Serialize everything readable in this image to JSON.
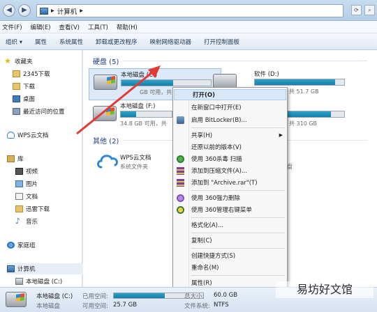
{
  "address": {
    "path": "计算机",
    "separator": "▸"
  },
  "menu": [
    "文件(F)",
    "编辑(E)",
    "查看(V)",
    "工具(T)",
    "帮助(H)"
  ],
  "toolbar": [
    "组织 ▾",
    "属性",
    "系统属性",
    "卸载或更改程序",
    "映射网络驱动器",
    "打开控制面板"
  ],
  "sidebar": {
    "favorites": "收藏夹",
    "fav_items": [
      "2345下载",
      "下载",
      "桌面",
      "最近访问的位置"
    ],
    "wps": "WPS云文档",
    "library": "库",
    "lib_items": [
      "视频",
      "图片",
      "文档",
      "迅雷下载",
      "音乐"
    ],
    "homegroup": "家庭组",
    "computer": "计算机",
    "computer_items": [
      "本地磁盘 (C:)"
    ]
  },
  "groups": {
    "hdd": "硬盘 (5)",
    "other": "其他 (2)"
  },
  "drives": [
    {
      "name": "本地磁盘 (C:)",
      "info": "GB 可用，共",
      "used_fraction": 0.58
    },
    {
      "name": "软件 (D:)",
      "info": "共 51.7 GB",
      "used_fraction": 0.9
    },
    {
      "name": "本地磁盘 (F:)",
      "info": "34.8 GB 可用，共",
      "used_fraction": 0.3
    },
    {
      "name": "",
      "info": "共 310 GB",
      "used_fraction": 0.85
    }
  ],
  "other_items": [
    {
      "name": "WPS云文档",
      "info": "系统文件夹"
    },
    {
      "name": "度网盘",
      "info": ""
    }
  ],
  "context_menu": {
    "open": "打开(O)",
    "open_new_window": "在新窗口中打开(E)",
    "bitlocker": "启用 BitLocker(B)...",
    "share": "共享(H)",
    "restore": "还原以前的版本(V)",
    "scan360": "使用 360杀毒 扫描",
    "add_archive": "添加到压缩文件(A)...",
    "add_rar": "添加到 \"Archive.rar\"(T)",
    "force_delete": "使用 360强力删除",
    "menu360": "使用 360管理右键菜单",
    "format": "格式化(A)...",
    "copy": "复制(C)",
    "shortcut": "创建快捷方式(S)",
    "rename": "重命名(M)",
    "properties": "属性(R)"
  },
  "status": {
    "drive_name": "本地磁盘 (C:)",
    "used_label": "已用空间:",
    "type": "本地磁盘",
    "free_label": "可用空间:",
    "free_value": "25.7 GB",
    "total_label": "总大小:",
    "total_value": "60.0 GB",
    "fs_label": "文件系统:",
    "fs_value": "NTFS",
    "used_fraction": 0.57
  },
  "watermark": "易坊好文馆",
  "colors": {
    "accent": "#1f7fb0",
    "header": "#1e3b8c",
    "red_arrow": "#e53935"
  }
}
